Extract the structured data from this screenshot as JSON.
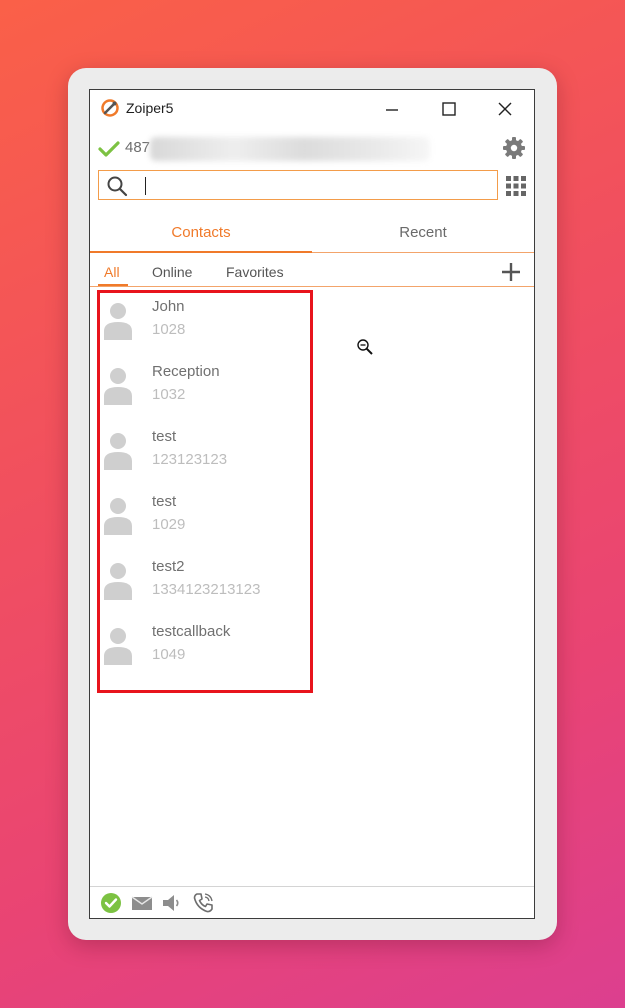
{
  "window": {
    "title": "Zoiper5"
  },
  "account": {
    "number_visible": "487"
  },
  "search": {
    "value": "",
    "placeholder": ""
  },
  "tabs": [
    {
      "label": "Contacts",
      "active": true
    },
    {
      "label": "Recent",
      "active": false
    }
  ],
  "filters": [
    {
      "label": "All",
      "active": true
    },
    {
      "label": "Online",
      "active": false
    },
    {
      "label": "Favorites",
      "active": false
    }
  ],
  "contacts": [
    {
      "name": "John",
      "number": "1028"
    },
    {
      "name": "Reception",
      "number": "1032"
    },
    {
      "name": "test",
      "number": "123123123"
    },
    {
      "name": "test",
      "number": "1029"
    },
    {
      "name": "test2",
      "number": "1334123213123"
    },
    {
      "name": "testcallback",
      "number": "1049"
    }
  ],
  "icons": {
    "app_logo": "zoiper-logo-icon",
    "account_status": "check-icon",
    "settings": "gear-icon",
    "search": "search-icon",
    "dialpad": "dialpad-icon",
    "add_contact": "plus-icon",
    "cursor": "zoom-out-cursor-icon",
    "status_online": "online-status-icon",
    "voicemail": "envelope-icon",
    "audio": "speaker-icon",
    "call": "phone-icon"
  },
  "colors": {
    "accent": "#f07a2a",
    "highlight": "#e8141c",
    "online_green": "#7cc242",
    "background_start": "#fa6048",
    "background_end": "#dc3f8f"
  }
}
